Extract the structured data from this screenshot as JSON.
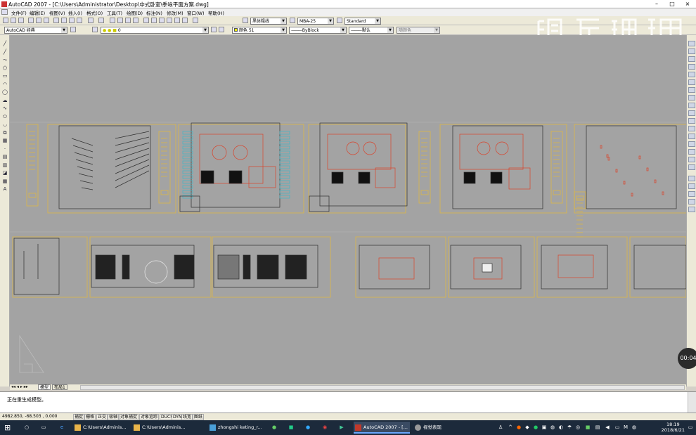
{
  "window": {
    "title": "AutoCAD 2007 - [C:\\Users\\Administrator\\Desktop\\中式卧室\\季咏平面方案.dwg]"
  },
  "menu": [
    "文件(F)",
    "编辑(E)",
    "视图(V)",
    "插入(I)",
    "格式(O)",
    "工具(T)",
    "绘图(D)",
    "标注(N)",
    "修改(M)",
    "窗口(W)",
    "帮助(H)"
  ],
  "toolbar": {
    "text_style": "黑体粗线",
    "dim_style": "MBA-25",
    "table_style": "Standard",
    "workspace": "AutoCAD 经典",
    "layer": "0",
    "color": "颜色 51",
    "linetype": "ByBlock",
    "lineweight": "默认",
    "plotstyle": "随颜色"
  },
  "tabs": {
    "model": "模型",
    "layout": "布局1"
  },
  "command": {
    "text": "正在重生成模型。"
  },
  "status": {
    "coords": "4982.850, -68.503 , 0.000",
    "buttons": [
      "捕捉",
      "栅格",
      "正交",
      "极轴",
      "对象捕捉",
      "对象追踪",
      "DUCS",
      "DYN",
      "线宽",
      "图纸"
    ]
  },
  "taskbar": {
    "items": [
      {
        "label": "C:\\Users\\Adminis...",
        "icon_color": "#e8b44a"
      },
      {
        "label": "C:\\Users\\Adminis...",
        "icon_color": "#e8b44a"
      },
      {
        "label": "zhongshi keting_r...",
        "icon_color": "#4aa0d8"
      },
      {
        "label": "AutoCAD 2007 - [...",
        "icon_color": "#c0392b"
      },
      {
        "label": "视觉表现",
        "icon_color": "#999999"
      }
    ],
    "time": "18:19",
    "date": "2018/6/21"
  },
  "overlay": {
    "timer": "00:04",
    "watermark": "虎课网"
  },
  "colors": {
    "canvas": "#a3a3a3",
    "frame": "#e3b93a",
    "drawing": "#2f2f2f",
    "accent_red": "#d9432b",
    "cyan": "#3fb7c7"
  }
}
